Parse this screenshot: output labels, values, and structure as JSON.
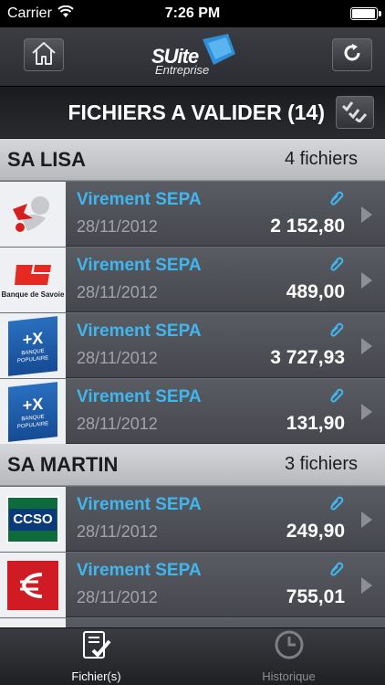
{
  "status_bar": {
    "carrier": "Carrier",
    "time": "7:26 PM",
    "battery_level": 0.95
  },
  "nav": {
    "logo_main": "SUite",
    "logo_sub": "Entreprise",
    "home_icon": "home-icon",
    "refresh_icon": "refresh-icon"
  },
  "title_bar": {
    "title": "FICHIERS A VALIDER (14)",
    "validate_icon": "validate-checks-icon"
  },
  "groups": [
    {
      "name": "SA LISA",
      "count": "4 fichiers",
      "rows": [
        {
          "bank": "lisa-logo",
          "type": "Virement SEPA",
          "date": "28/11/2012",
          "amount": "2 152,80"
        },
        {
          "bank": "banque-de-savoie",
          "bank_label": "Banque de Savoie",
          "type": "Virement SEPA",
          "date": "28/11/2012",
          "amount": "489,00"
        },
        {
          "bank": "banque-populaire",
          "bank_label": "BANQUE POPULAIRE",
          "type": "Virement SEPA",
          "date": "28/11/2012",
          "amount": "3 727,93"
        },
        {
          "bank": "banque-populaire",
          "bank_label": "BANQUE POPULAIRE",
          "type": "Virement SEPA",
          "date": "28/11/2012",
          "amount": "131,90"
        }
      ]
    },
    {
      "name": "SA MARTIN",
      "count": "3 fichiers",
      "rows": [
        {
          "bank": "ccso",
          "bank_label": "CCSO",
          "type": "Virement SEPA",
          "date": "28/11/2012",
          "amount": "249,90"
        },
        {
          "bank": "caisse-epargne",
          "type": "Virement SEPA",
          "date": "28/11/2012",
          "amount": "755,01"
        }
      ]
    }
  ],
  "tabs": [
    {
      "label": "Fichier(s)",
      "icon": "files-check-icon",
      "active": true
    },
    {
      "label": "Historique",
      "icon": "clock-icon",
      "active": false
    }
  ],
  "colors": {
    "accent": "#40b6ef",
    "background": "#4a4c52",
    "group_header": "#c8c9cc"
  }
}
